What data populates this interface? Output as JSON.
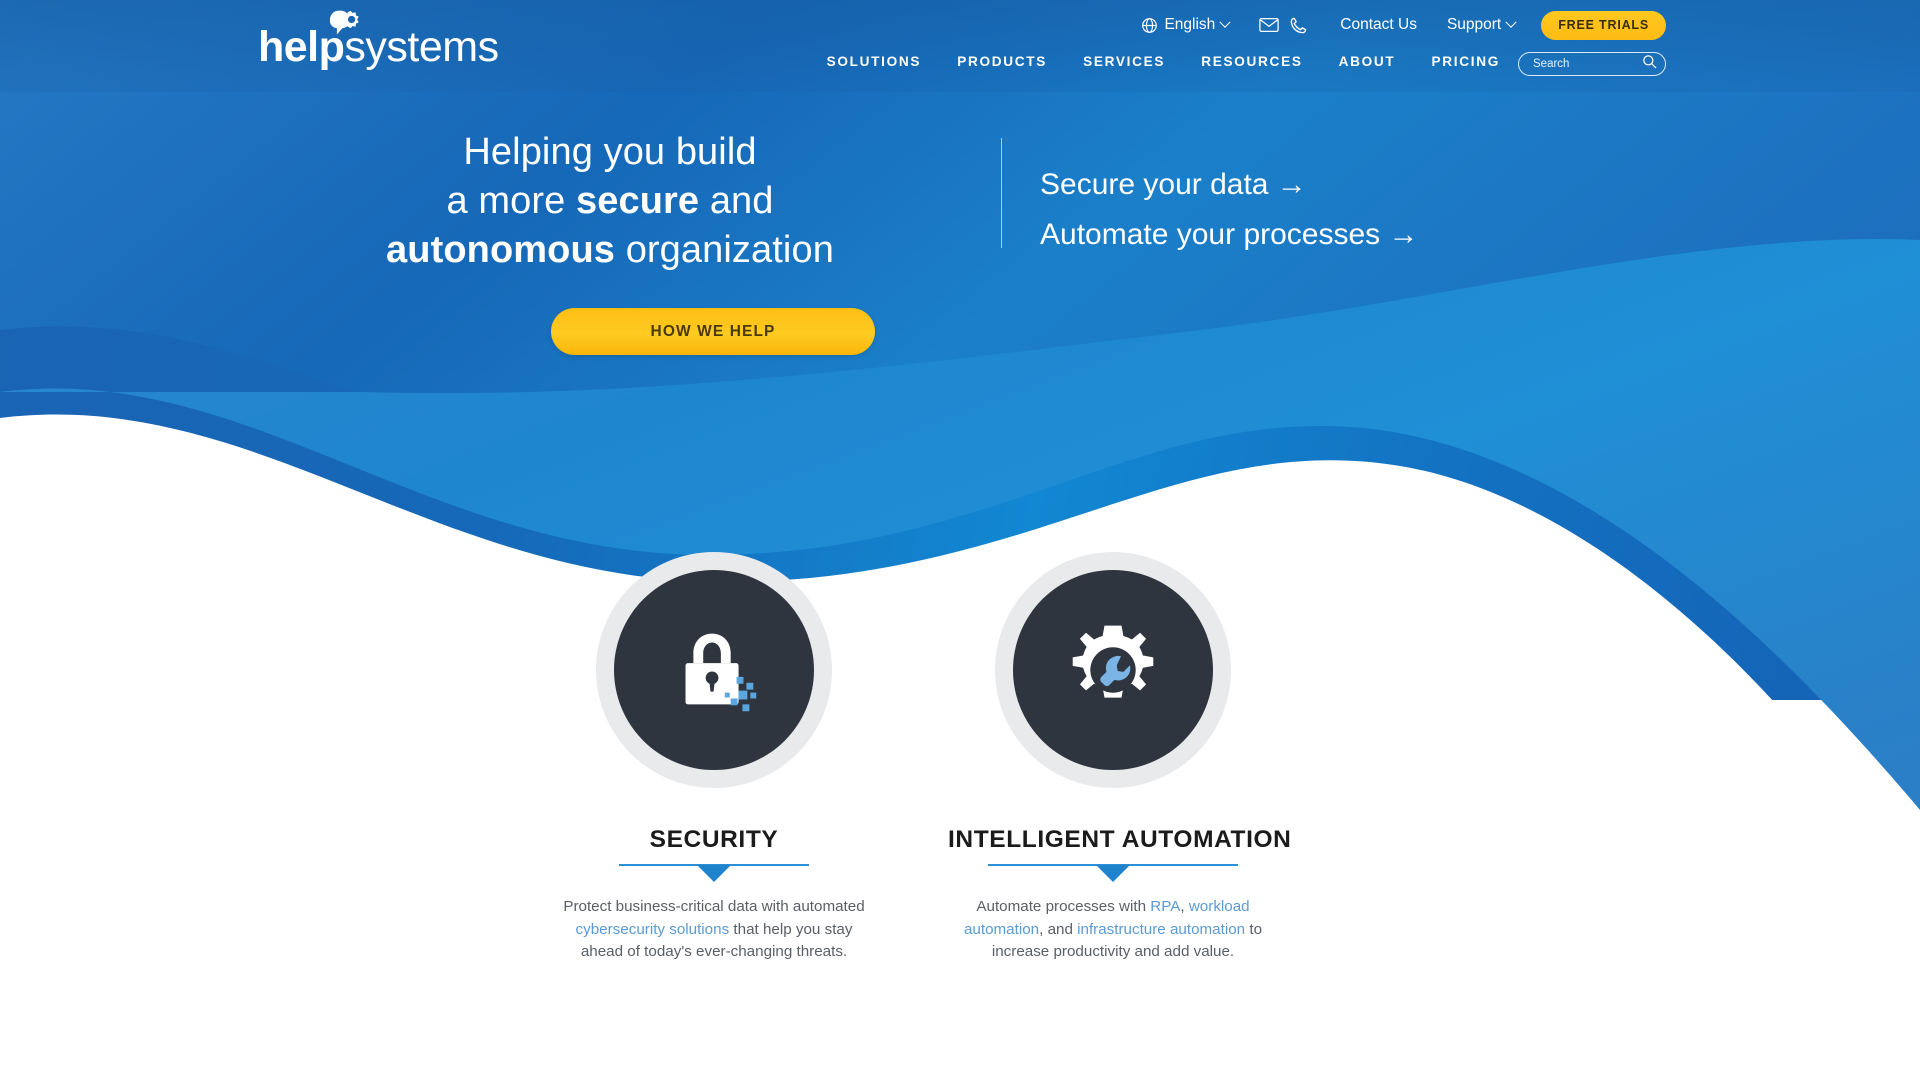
{
  "brand": {
    "logo_text_bold": "help",
    "logo_text_light": "systems",
    "accent_yellow": "#ffc41e",
    "accent_blue": "#1b72c0",
    "dark_circle": "#2f353f",
    "link_blue": "#5b9bd5"
  },
  "header": {
    "utility": {
      "language": "English",
      "language_icon": "globe-icon",
      "email_icon": "envelope-icon",
      "phone_icon": "phone-icon",
      "contact": "Contact Us",
      "support": "Support",
      "free_trials": "FREE TRIALS"
    },
    "nav": [
      {
        "label": "SOLUTIONS"
      },
      {
        "label": "PRODUCTS"
      },
      {
        "label": "SERVICES"
      },
      {
        "label": "RESOURCES"
      },
      {
        "label": "ABOUT"
      },
      {
        "label": "PRICING"
      }
    ],
    "search": {
      "placeholder": "Search",
      "value": "",
      "icon": "search-icon"
    }
  },
  "hero": {
    "headline_line1": "Helping you build",
    "headline_line2_pre": "a more ",
    "headline_line2_bold": "secure",
    "headline_line2_post": " and",
    "headline_line3_bold": "autonomous",
    "headline_line3_post": " organization",
    "cta_label": "HOW WE HELP",
    "links": [
      {
        "label": "Secure your data →"
      },
      {
        "label": "Automate your processes →"
      }
    ]
  },
  "cards": [
    {
      "id": "security",
      "icon": "padlock-icon",
      "title": "SECURITY",
      "body_parts": [
        {
          "text": "Protect business-critical data with automated ",
          "link": false
        },
        {
          "text": "cybersecurity solutions",
          "link": true
        },
        {
          "text": " that help you stay ahead of today's ever-changing threats.",
          "link": false
        }
      ]
    },
    {
      "id": "intelligent-automation",
      "icon": "gear-wrench-icon",
      "title": "INTELLIGENT AUTOMATION",
      "body_parts": [
        {
          "text": "Automate processes with ",
          "link": false
        },
        {
          "text": "RPA",
          "link": true
        },
        {
          "text": ", ",
          "link": false
        },
        {
          "text": "workload automation",
          "link": true
        },
        {
          "text": ", and ",
          "link": false
        },
        {
          "text": "infrastructure automation",
          "link": true
        },
        {
          "text": " to increase productivity and add value.",
          "link": false
        }
      ]
    }
  ]
}
